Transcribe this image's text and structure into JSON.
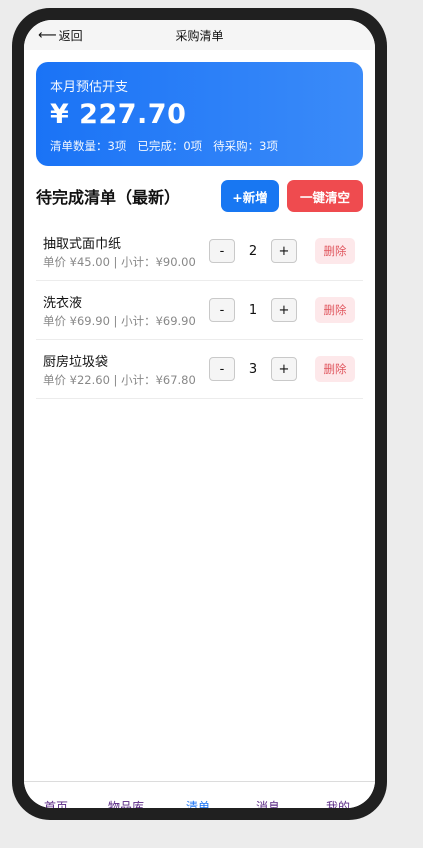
{
  "header": {
    "back_label": "返回",
    "title": "采购清单"
  },
  "summary": {
    "label": "本月预估开支",
    "amount": "¥ 227.70",
    "stat_count": "清单数量：3项",
    "stat_done": "已完成：0项",
    "stat_pending": "待采购：3项"
  },
  "section": {
    "title": "待完成清单（最新）",
    "add_label": "+新增",
    "clear_label": "一键清空"
  },
  "items": [
    {
      "name": "抽取式面巾纸",
      "detail": "单价 ¥45.00 | 小计：¥90.00",
      "qty": "2",
      "delete_label": "删除"
    },
    {
      "name": "洗衣液",
      "detail": "单价 ¥69.90 | 小计：¥69.90",
      "qty": "1",
      "delete_label": "删除"
    },
    {
      "name": "厨房垃圾袋",
      "detail": "单价 ¥22.60 | 小计：¥67.80",
      "qty": "3",
      "delete_label": "删除"
    }
  ],
  "stepper": {
    "minus": "-",
    "plus": "+"
  },
  "tabs": [
    {
      "label": "首页"
    },
    {
      "label": "物品库"
    },
    {
      "label": "清单"
    },
    {
      "label": "消息"
    },
    {
      "label": "我的"
    }
  ],
  "colors": {
    "accent": "#1a73f6",
    "danger": "#ef4b4f",
    "tab_inactive": "#5b2a86"
  }
}
